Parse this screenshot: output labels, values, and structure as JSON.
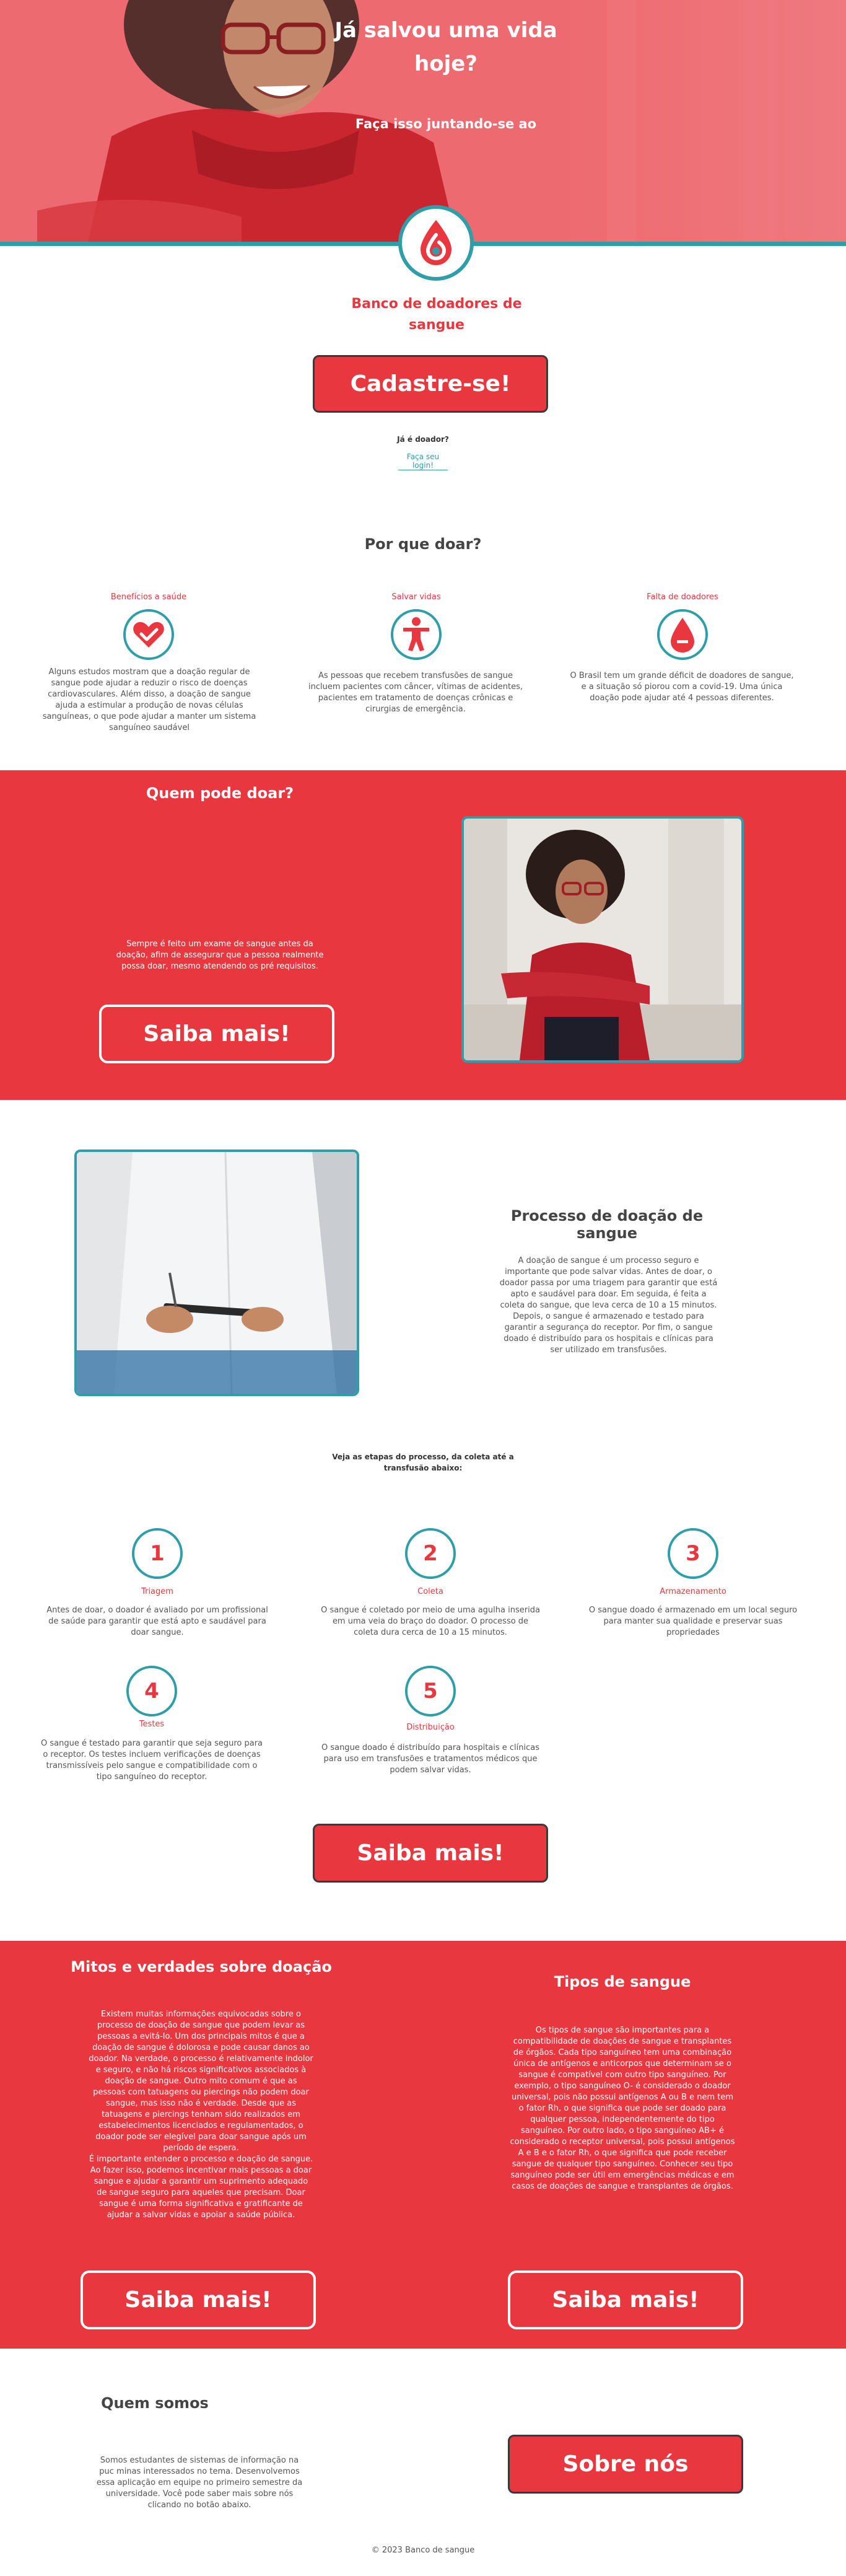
{
  "hero": {
    "title": "Já salvou uma vida hoje?",
    "subtitle": "Faça isso juntando-se ao"
  },
  "brand": {
    "name": "Banco de doadores de sangue",
    "logo_icon": "blood-drop-logo-icon"
  },
  "signup": {
    "button_label": "Cadastre-se!",
    "already_donor": "Já é doador?",
    "login_link": "Faça seu login!"
  },
  "why": {
    "title": "Por que doar?",
    "items": [
      {
        "label": "Benefícios a saúde",
        "icon": "heart-check-icon",
        "text": "Alguns estudos mostram que a doação regular de sangue pode ajudar a reduzir o risco de doenças cardiovasculares. Além disso, a doação de sangue ajuda a estimular a produção de novas células sanguíneas, o que pode ajudar a manter um sistema sanguíneo saudável"
      },
      {
        "label": "Salvar vidas",
        "icon": "person-icon",
        "text": "As pessoas que recebem transfusões de sangue incluem pacientes com câncer, vítimas de acidentes, pacientes em tratamento de doenças crônicas e cirurgias de emergência."
      },
      {
        "label": "Falta de doadores",
        "icon": "blood-drop-minus-icon",
        "text": "O Brasil tem um grande déficit de doadores de sangue, e a situação só piorou com a covid-19. Uma única doação pode ajudar até 4 pessoas diferentes."
      }
    ]
  },
  "who": {
    "title": "Quem pode doar?",
    "text": "Sempre é feito um exame de sangue antes da doação, afim de assegurar que a pessoa realmente possa doar, mesmo atendendo os pré requisitos.",
    "button_label": "Saiba mais!"
  },
  "process": {
    "title": "Processo de doação de sangue",
    "text": "A doação de sangue é um processo seguro e importante que pode salvar vidas. Antes de doar, o doador passa por uma triagem para garantir que está apto e saudável para doar. Em seguida, é feita a coleta do sangue, que leva cerca de 10 a 15 minutos. Depois, o sangue é armazenado e testado para garantir a segurança do receptor. Por fim, o sangue doado é distribuído para os hospitais e clínicas para ser utilizado em transfusões.",
    "steps_intro": "Veja as etapas do processo, da coleta até a transfusão abaixo:",
    "steps": [
      {
        "number": "1",
        "label": "Triagem",
        "text": "Antes de doar, o doador é avaliado por um profissional de saúde para garantir que está apto e saudável para doar sangue."
      },
      {
        "number": "2",
        "label": "Coleta",
        "text": "O sangue é coletado por meio de uma agulha inserida em uma veia do braço do doador. O processo de coleta dura cerca de 10 a 15 minutos."
      },
      {
        "number": "3",
        "label": "Armazenamento",
        "text": "O sangue doado é armazenado em um local seguro para manter sua qualidade e preservar suas propriedades"
      },
      {
        "number": "4",
        "label": "Testes",
        "text": "O sangue é testado para garantir que seja seguro para o receptor. Os testes incluem verificações de doenças transmissíveis pelo sangue e compatibilidade com o tipo sanguíneo do receptor."
      },
      {
        "number": "5",
        "label": "Distribuição",
        "text": "O sangue doado é distribuído para hospitais e clínicas para uso em transfusões e tratamentos médicos que podem salvar vidas."
      }
    ],
    "button_label": "Saiba mais!"
  },
  "myths": {
    "title": "Mitos e verdades sobre doação",
    "text1": "Existem muitas informações equivocadas sobre o processo de doação de sangue que podem levar as pessoas a evitá-lo. Um dos principais mitos é que a doação de sangue é dolorosa e pode causar danos ao doador. Na verdade, o processo é relativamente indolor e seguro, e não há riscos significativos associados à doação de sangue. Outro mito comum é que as pessoas com tatuagens ou piercings não podem doar sangue, mas isso não é verdade. Desde que as tatuagens e piercings tenham sido realizados em estabelecimentos licenciados e regulamentados, o doador pode ser elegível para doar sangue após um período de espera.",
    "text2": "É importante entender o processo e doação de sangue. Ao fazer isso, podemos incentivar mais pessoas a doar sangue e ajudar a garantir um suprimento adequado de sangue seguro para aqueles que precisam. Doar sangue é uma forma significativa e gratificante de ajudar a salvar vidas e apoiar a saúde pública.",
    "button_label": "Saiba mais!"
  },
  "types": {
    "title": "Tipos de sangue",
    "text": "Os tipos de sangue são importantes para a compatibilidade de doações de sangue e transplantes de órgãos. Cada tipo sanguíneo tem uma combinação única de antígenos e anticorpos que determinam se o sangue é compatível com outro tipo sanguíneo. Por exemplo, o tipo sanguíneo O- é considerado o doador universal, pois não possui antígenos A ou B e nem tem o fator Rh, o que significa que pode ser doado para qualquer pessoa, independentemente do tipo sanguíneo. Por outro lado, o tipo sanguíneo AB+ é considerado o receptor universal, pois possui antígenos A e B e o fator Rh, o que significa que pode receber sangue de qualquer tipo sanguíneo. Conhecer seu tipo sanguíneo pode ser útil em emergências médicas e em casos de doações de sangue e transplantes de órgãos.",
    "button_label": "Saiba mais!"
  },
  "about": {
    "title": "Quem somos",
    "text": "Somos estudantes de sistemas de informação na puc minas interessados no tema. Desenvolvemos essa aplicação em equipe no primeiro semestre da universidade. Você pode saber mais sobre nós clicando no botão abaixo.",
    "button_label": "Sobre nós"
  },
  "footer": {
    "text": "© 2023 Banco de sangue"
  },
  "colors": {
    "primary_red": "#e8373e",
    "teal": "#2f9ea8",
    "hero_red": "#ed6a70"
  }
}
